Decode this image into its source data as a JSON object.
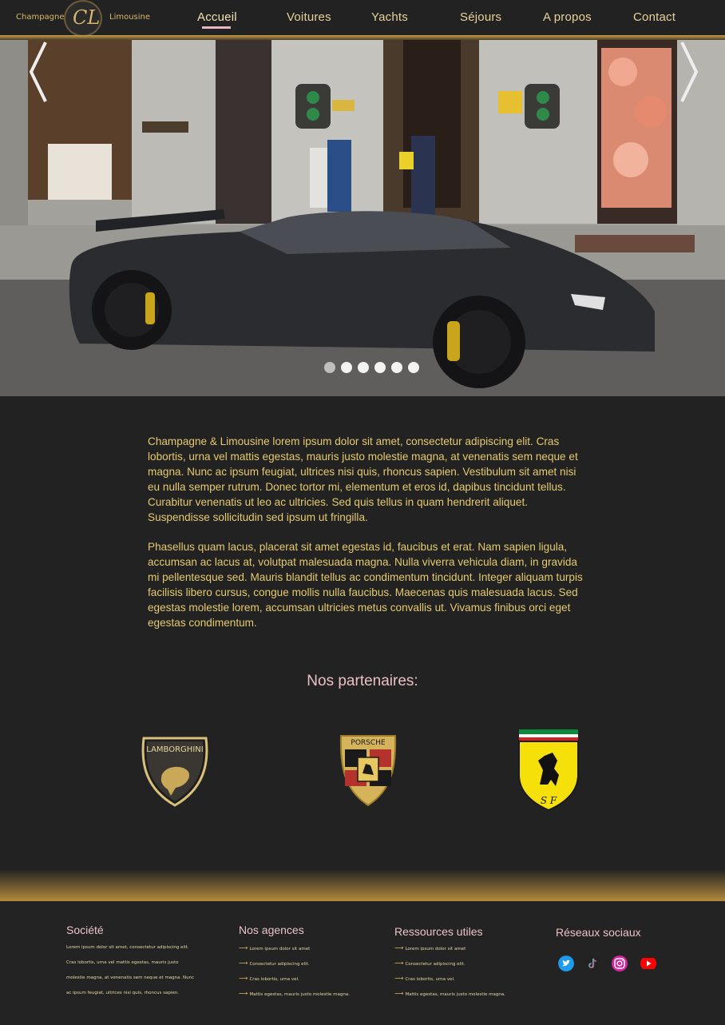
{
  "brand": {
    "name_left": "Champagne",
    "name_right": "Limousine",
    "monogram": "CL"
  },
  "nav": {
    "items": [
      {
        "label": "Accueil",
        "active": true
      },
      {
        "label": "Voitures"
      },
      {
        "label": "Yachts"
      },
      {
        "label": "Séjours"
      },
      {
        "label": "A propos"
      },
      {
        "label": "Contact"
      }
    ]
  },
  "hero": {
    "slide_count": 6,
    "active_slide": 1
  },
  "intro": {
    "paragraph_1": "Champagne & Limousine lorem ipsum dolor sit amet, consectetur adipiscing elit. Cras lobortis, urna vel mattis egestas, mauris justo molestie magna, at venenatis sem neque et magna. Nunc ac ipsum feugiat, ultrices nisi quis, rhoncus sapien. Vestibulum sit amet nisi eu nulla semper rutrum. Donec tortor mi, elementum et eros id, dapibus tincidunt tellus. Curabitur venenatis ut leo ac ultricies. Sed quis tellus in quam hendrerit aliquet. Suspendisse sollicitudin sed ipsum ut fringilla.",
    "paragraph_2": "Phasellus quam lacus, placerat sit amet egestas id, faucibus et erat. Nam sapien ligula, accumsan ac lacus at, volutpat malesuada magna. Nulla viverra vehicula diam, in gravida mi pellentesque sed. Mauris blandit tellus ac condimentum tincidunt. Integer aliquam turpis facilisis libero cursus, congue mollis nulla faucibus. Maecenas quis malesuada lacus. Sed egestas molestie lorem, accumsan ultricies metus convallis ut. Vivamus finibus orci eget egestas condimentum."
  },
  "partners": {
    "title": "Nos partenaires:",
    "logos": [
      {
        "name": "Lamborghini",
        "label": "LAMBORGHINI"
      },
      {
        "name": "Porsche",
        "label": "PORSCHE"
      },
      {
        "name": "Ferrari",
        "label": "S F"
      }
    ]
  },
  "footer": {
    "societe": {
      "title": "Société",
      "text": "Lorem ipsum dolor sit amet, consectetur adipiscing elit. Cras lobortis, urna vel mattis egestas, mauris justo molestie magna, at venenatis sem neque et magna. Nunc ac ipsum feugiat, ultrices nisi quis, rhoncus sapien."
    },
    "agences": {
      "title": "Nos agences",
      "items": [
        "Lorem ipsum dolor sit amet",
        "Consectetur adipiscing elit.",
        "Cras lobortis, urna vel.",
        "Mattis egestas, mauris justo molestie magna."
      ]
    },
    "ressources": {
      "title": "Ressources utiles",
      "items": [
        "Lorem ipsum dolor sit amet",
        "Consectetur adipiscing elit.",
        "Cras lobortis, urna vel.",
        "Mattis egestas, mauris justo molestie magna."
      ]
    },
    "social": {
      "title": "Réseaux sociaux",
      "networks": [
        "twitter-icon",
        "tiktok-icon",
        "instagram-icon",
        "youtube-icon"
      ]
    }
  },
  "colors": {
    "background": "#222222",
    "gold": "#c79d48",
    "text_gold": "#e5ca6e",
    "pink": "#eac0c4"
  }
}
